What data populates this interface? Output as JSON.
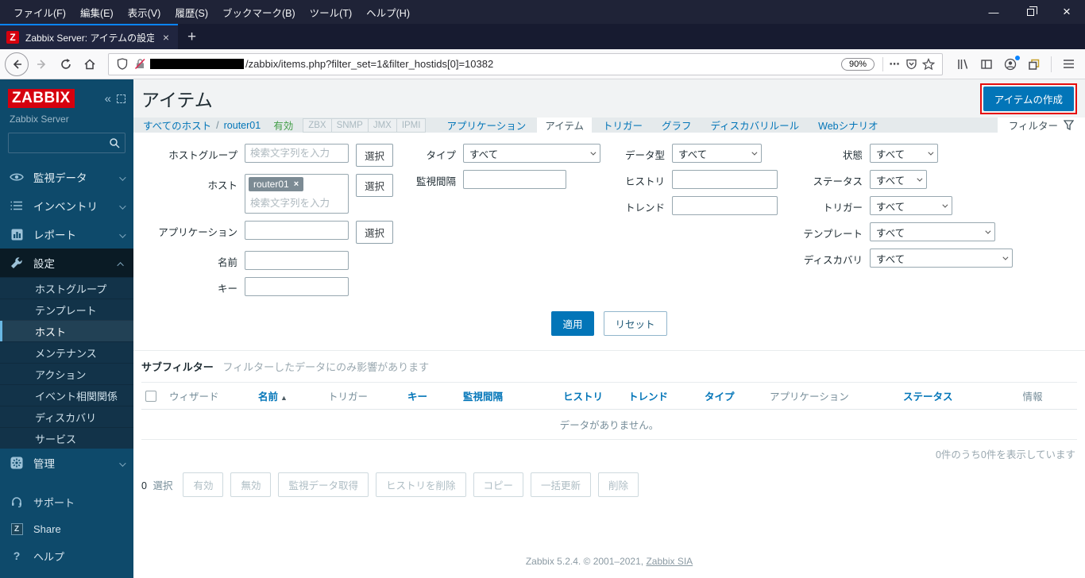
{
  "colors": {
    "accent": "#0275b8",
    "sidebar_bg": "#0e4a6b",
    "status_green": "#429e47",
    "highlight_red": "#e60d0d",
    "browser_bar": "#1f2337",
    "logo_red": "#d6000e"
  },
  "browser": {
    "menu": [
      "ファイル(F)",
      "編集(E)",
      "表示(V)",
      "履歴(S)",
      "ブックマーク(B)",
      "ツール(T)",
      "ヘルプ(H)"
    ],
    "tab": {
      "favicon_letter": "Z",
      "title": "Zabbix Server: アイテムの設定",
      "close": "×",
      "new_tab": "+"
    },
    "url_path": "/zabbix/items.php?filter_set=1&filter_hostids[0]=10382",
    "zoom_level": "90%",
    "window": {
      "minimize": "—",
      "close": "×"
    }
  },
  "sidebar": {
    "logo": "ZABBIX",
    "collapse_icon": "«",
    "server_name": "Zabbix Server",
    "menu": [
      {
        "label": "監視データ"
      },
      {
        "label": "インベントリ"
      },
      {
        "label": "レポート"
      },
      {
        "label": "設定"
      }
    ],
    "submenu": [
      "ホストグループ",
      "テンプレート",
      "ホスト",
      "メンテナンス",
      "アクション",
      "イベント相関関係",
      "ディスカバリ",
      "サービス"
    ],
    "selected_submenu": "ホスト",
    "admin": {
      "label": "管理"
    },
    "footer": [
      {
        "label": "サポート"
      },
      {
        "label": "Share"
      },
      {
        "label": "ヘルプ"
      }
    ]
  },
  "page": {
    "title": "アイテム",
    "create_button": "アイテムの作成",
    "breadcrumb": {
      "all_hosts": "すべてのホスト",
      "separator": "/",
      "host": "router01"
    },
    "status": "有効",
    "interfaces": [
      "ZBX",
      "SNMP",
      "JMX",
      "IPMI"
    ],
    "tabs": [
      "アプリケーション",
      "アイテム",
      "トリガー",
      "グラフ",
      "ディスカバリルール",
      "Webシナリオ"
    ],
    "active_tab": "アイテム",
    "filter_tab": "フィルター"
  },
  "filter": {
    "host_group": {
      "label": "ホストグループ",
      "placeholder": "検索文字列を入力",
      "select_button": "選択"
    },
    "host": {
      "label": "ホスト",
      "chip": "router01",
      "chip_remove": "×",
      "placeholder": "検索文字列を入力",
      "select_button": "選択"
    },
    "application": {
      "label": "アプリケーション",
      "select_button": "選択"
    },
    "name": {
      "label": "名前"
    },
    "key": {
      "label": "キー"
    },
    "type": {
      "label": "タイプ",
      "value": "すべて"
    },
    "interval": {
      "label": "監視間隔"
    },
    "data_type": {
      "label": "データ型",
      "value": "すべて"
    },
    "history": {
      "label": "ヒストリ"
    },
    "trends": {
      "label": "トレンド"
    },
    "state": {
      "label": "状態",
      "value": "すべて"
    },
    "status": {
      "label": "ステータス",
      "value": "すべて"
    },
    "triggers": {
      "label": "トリガー",
      "value": "すべて"
    },
    "template": {
      "label": "テンプレート",
      "value": "すべて"
    },
    "discovery": {
      "label": "ディスカバリ",
      "value": "すべて"
    },
    "apply_button": "適用",
    "reset_button": "リセット"
  },
  "subfilter": {
    "title": "サブフィルター",
    "hint": "フィルターしたデータにのみ影響があります"
  },
  "table": {
    "columns": [
      {
        "label": "ウィザード"
      },
      {
        "label": "名前"
      },
      {
        "label": "トリガー"
      },
      {
        "label": "キー"
      },
      {
        "label": "監視間隔"
      },
      {
        "label": "ヒストリ"
      },
      {
        "label": "トレンド"
      },
      {
        "label": "タイプ"
      },
      {
        "label": "アプリケーション"
      },
      {
        "label": "ステータス"
      },
      {
        "label": "情報"
      }
    ],
    "sort_arrow": "▲",
    "empty_text": "データがありません。",
    "paging_text": "0件のうち0件を表示しています"
  },
  "actions": {
    "selected_count": "0",
    "selected_label": "選択",
    "buttons": [
      "有効",
      "無効",
      "監視データ取得",
      "ヒストリを削除",
      "コピー",
      "一括更新",
      "削除"
    ]
  },
  "footer": {
    "text": "Zabbix 5.2.4. © 2001–2021,",
    "link": "Zabbix SIA"
  }
}
